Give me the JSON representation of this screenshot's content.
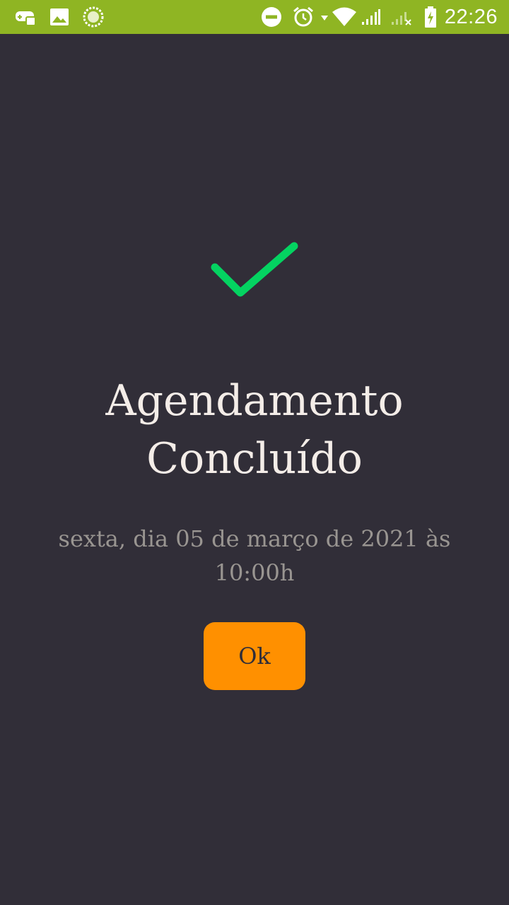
{
  "status_bar": {
    "time": "22:26",
    "left_icons": [
      "game-controller-icon",
      "image-icon",
      "circular-progress-icon"
    ],
    "right_icons": [
      "do-not-disturb-icon",
      "alarm-icon",
      "wifi-icon",
      "signal-icon",
      "signal-no-service-icon",
      "battery-charging-icon"
    ],
    "background_color": "#8fb523"
  },
  "main": {
    "check_icon": "check-icon",
    "check_color": "#04d361",
    "title_line_1": "Agendamento",
    "title_line_2": "Concluído",
    "subtitle": "sexta, dia 05 de março de 2021 às 10:00h",
    "ok_label": "Ok",
    "background_color": "#312e38",
    "button_color": "#ff9000"
  }
}
